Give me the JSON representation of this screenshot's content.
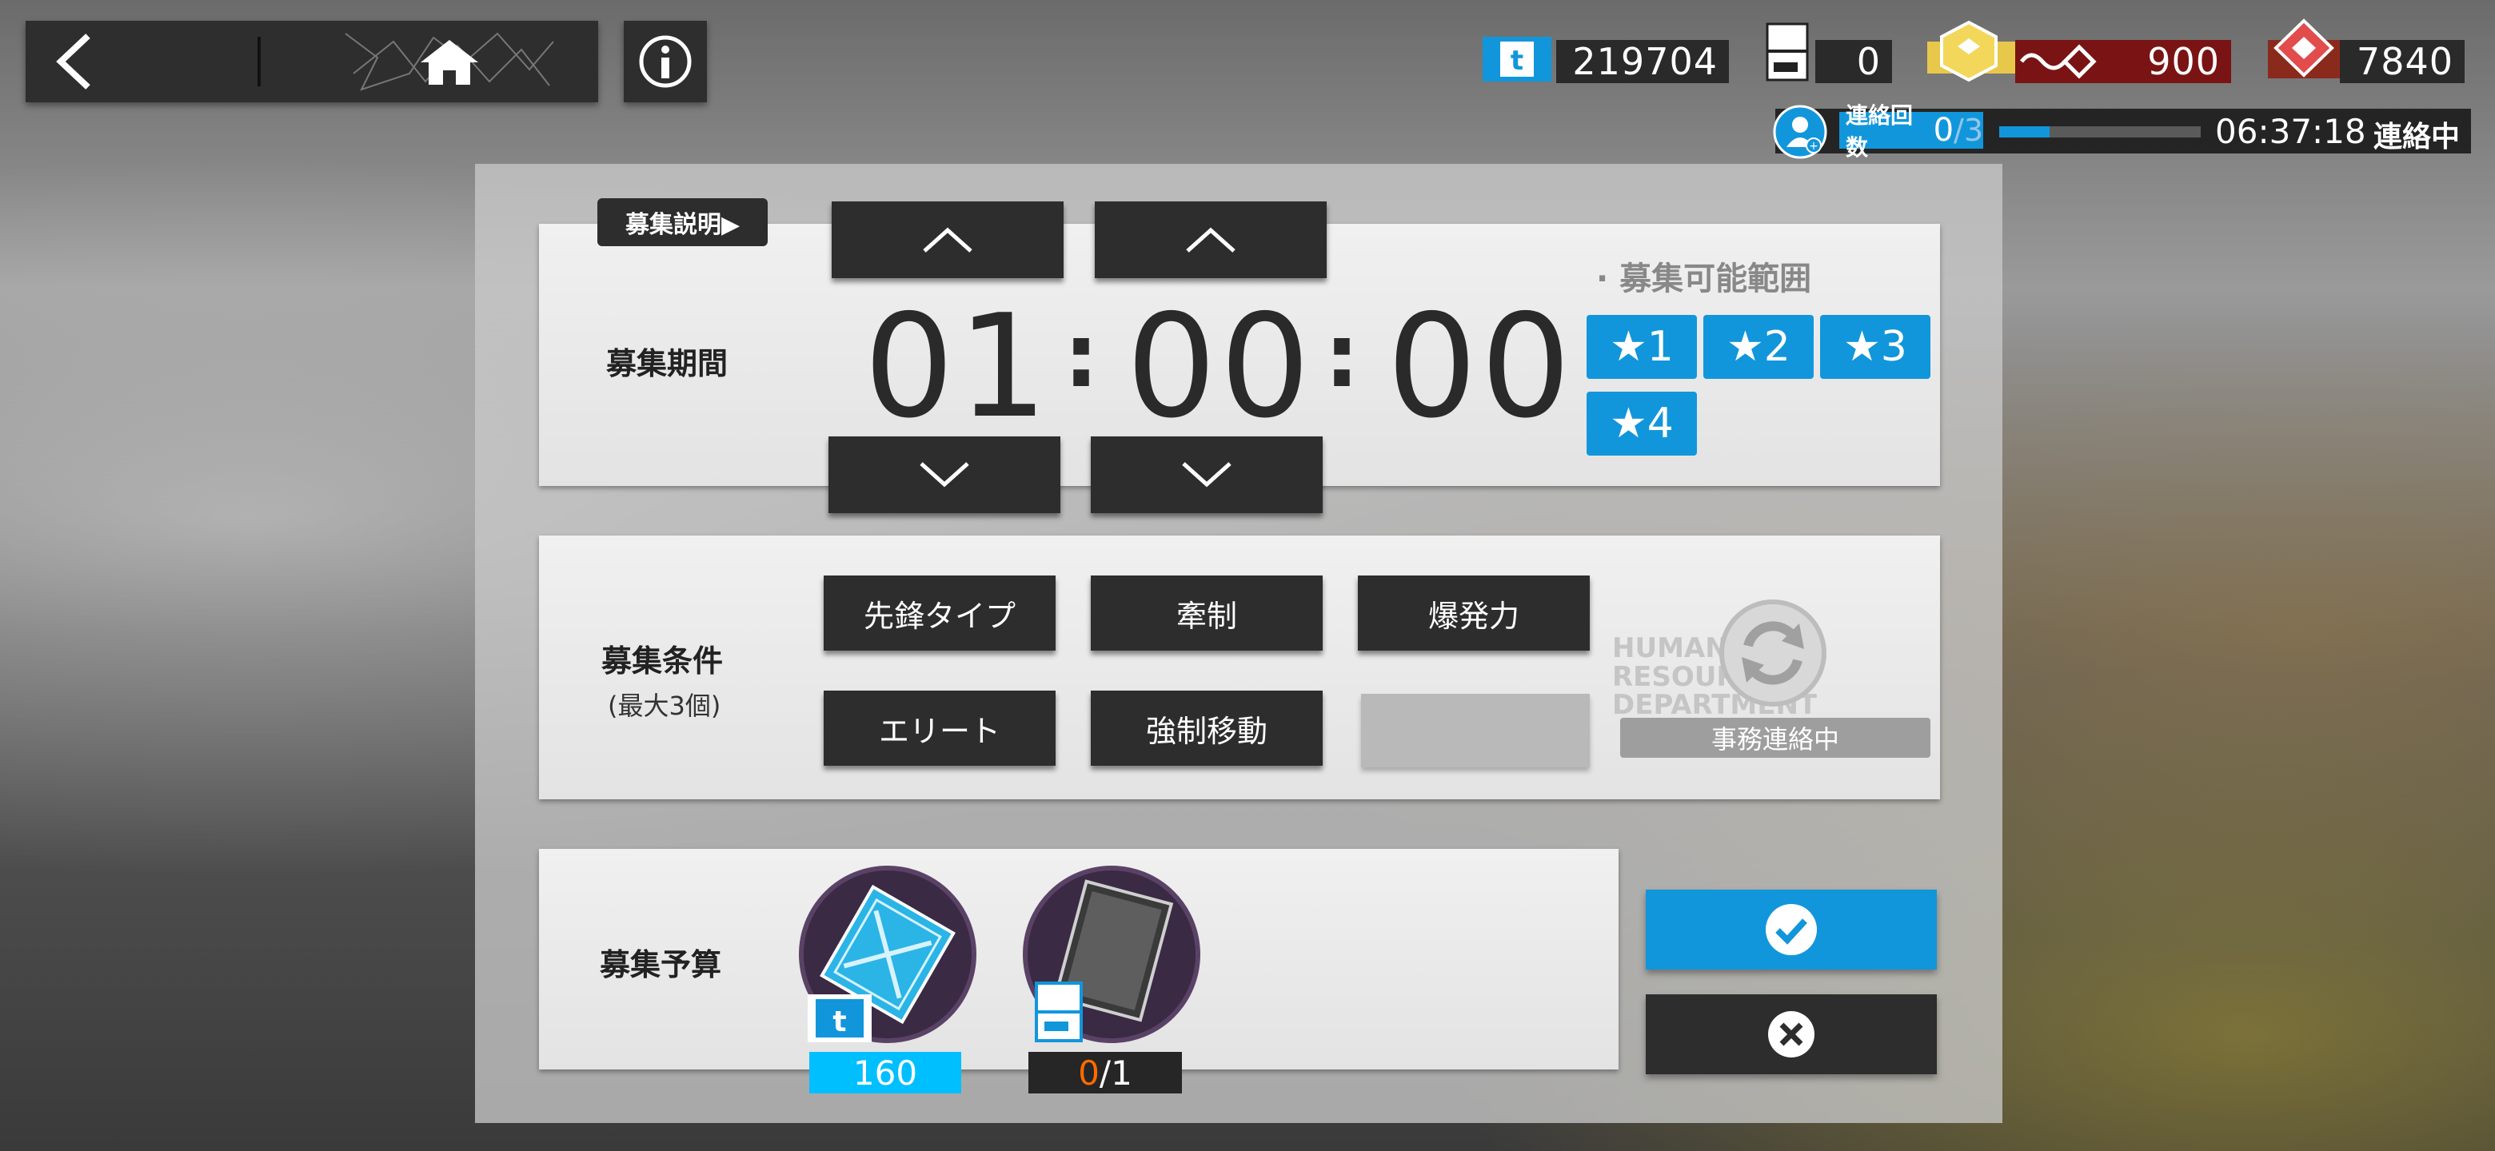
{
  "topbar": {
    "resources": [
      {
        "icon": "recruit-permit-icon",
        "value": "219704"
      },
      {
        "icon": "expedited-plan-icon",
        "value": "0"
      },
      {
        "icon": "lmd-icon",
        "value": "900"
      },
      {
        "icon": "orundum-icon",
        "value": "7840"
      }
    ],
    "contact": {
      "label": "連絡回数",
      "count_current": "0",
      "count_total": "/3",
      "progress": 0.25,
      "timer": "06:37:18",
      "status": "連絡中"
    }
  },
  "recruit": {
    "hint_label": "募集説明▶",
    "time": {
      "label": "募集期間",
      "hours": "01",
      "minutes": "00",
      "seconds": "00",
      "colon": ":"
    },
    "range": {
      "title": "· 募集可能範囲",
      "stars": [
        "★1",
        "★2",
        "★3",
        "★4"
      ]
    },
    "tags": {
      "label": "募集条件",
      "sublabel": "(最大3個)",
      "items": [
        "先鋒タイプ",
        "牽制",
        "爆発力",
        "エリート",
        "強制移動"
      ]
    },
    "refresh": {
      "watermark": "HUMAN RESOURCES DEPARTMENT",
      "status": "事務連絡中"
    },
    "budget": {
      "label": "募集予算",
      "permit_cost": "160",
      "plan_current": "0",
      "plan_total": "/1"
    }
  },
  "colors": {
    "accent": "#1296db",
    "dark": "#2d2d2d",
    "orange": "#ff6a00",
    "cost_bg": "#00bfff"
  }
}
